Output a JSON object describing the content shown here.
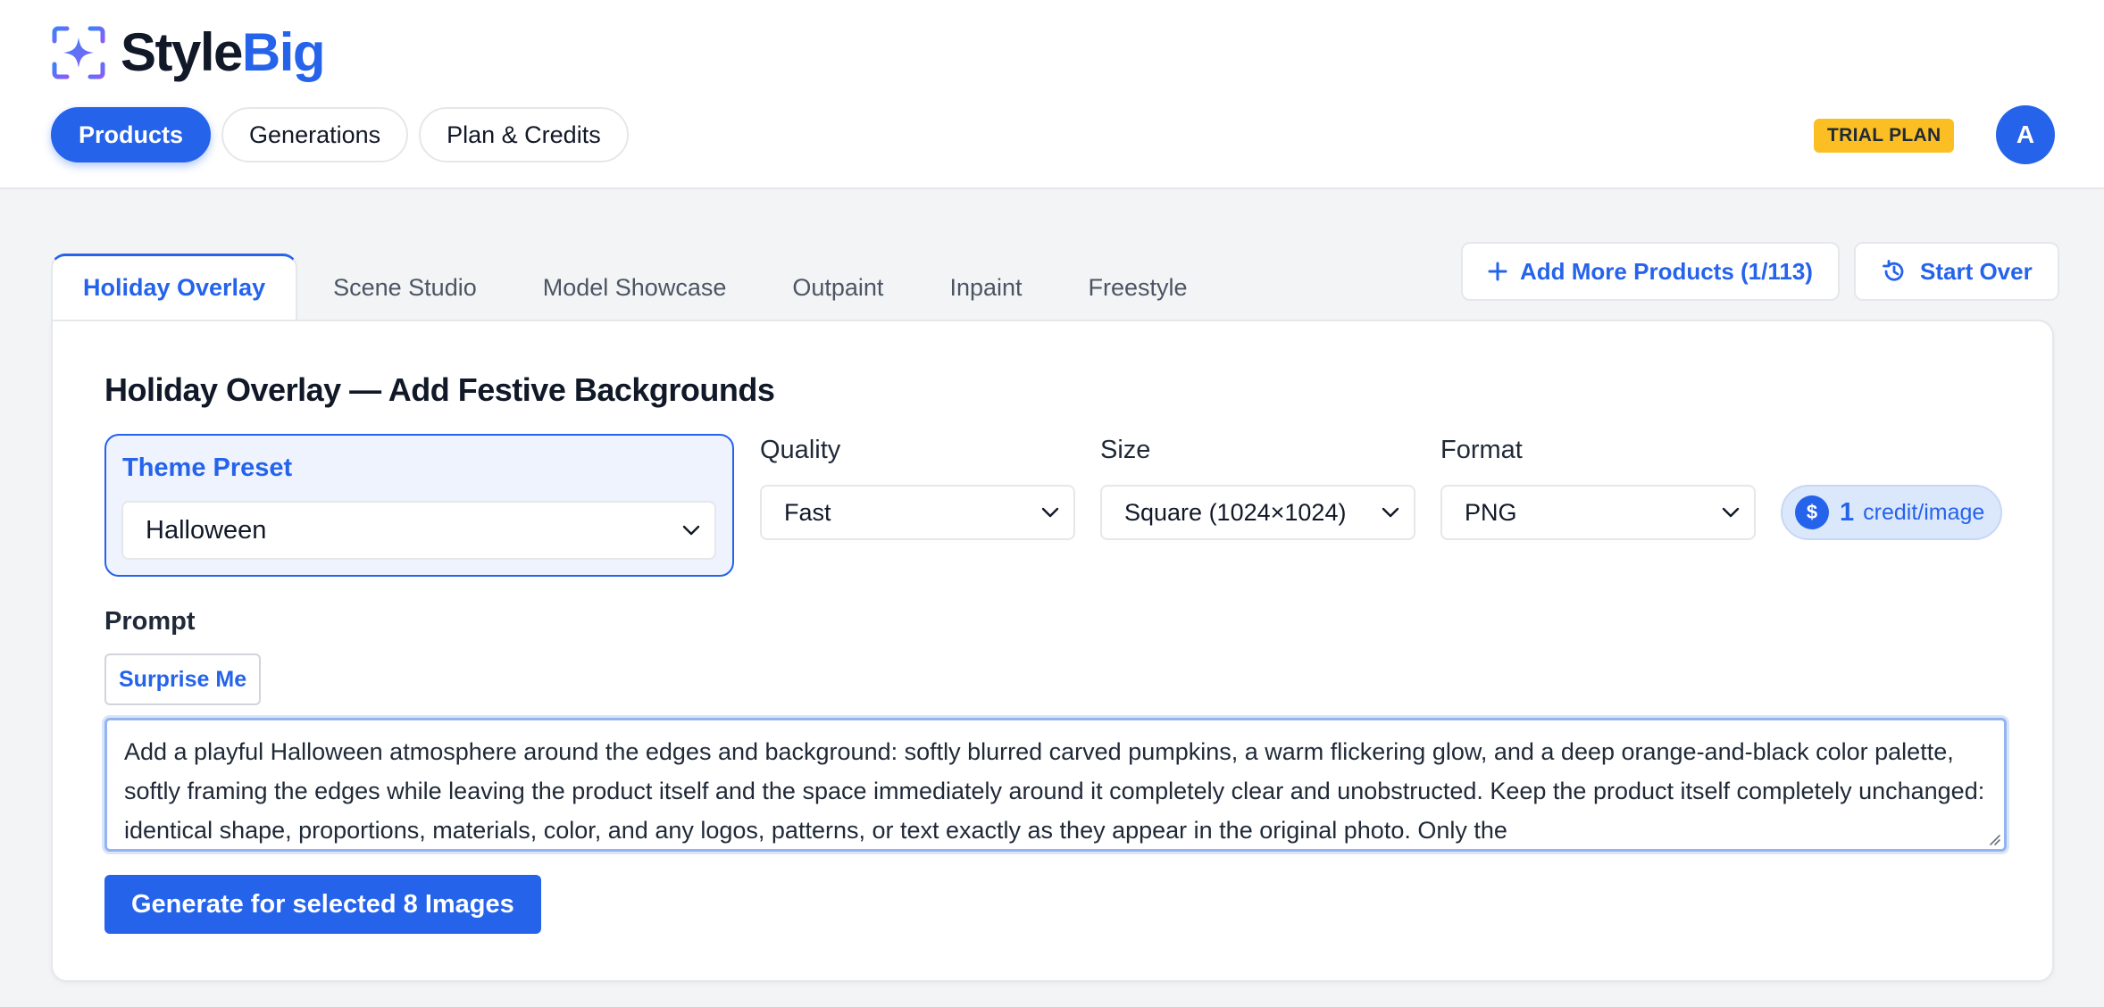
{
  "brand": {
    "name_part1": "Style",
    "name_part2": "Big",
    "logo_icon": "sparkle-frame-icon"
  },
  "nav": {
    "items": [
      {
        "label": "Products",
        "active": true
      },
      {
        "label": "Generations",
        "active": false
      },
      {
        "label": "Plan & Credits",
        "active": false
      }
    ]
  },
  "account": {
    "plan_badge": "TRIAL PLAN",
    "avatar_initial": "A"
  },
  "tabs": [
    {
      "label": "Holiday Overlay",
      "active": true
    },
    {
      "label": "Scene Studio"
    },
    {
      "label": "Model Showcase"
    },
    {
      "label": "Outpaint"
    },
    {
      "label": "Inpaint"
    },
    {
      "label": "Freestyle"
    }
  ],
  "actions": {
    "add_more_label": "Add More Products (1/113)",
    "add_more_icon": "plus-icon",
    "start_over_label": "Start Over",
    "start_over_icon": "history-icon"
  },
  "panel": {
    "title": "Holiday Overlay — Add Festive Backgrounds",
    "theme_preset": {
      "label": "Theme Preset",
      "value": "Halloween"
    },
    "quality": {
      "label": "Quality",
      "value": "Fast"
    },
    "size": {
      "label": "Size",
      "value": "Square (1024×1024)"
    },
    "format": {
      "label": "Format",
      "value": "PNG"
    },
    "credit": {
      "icon": "$",
      "amount": "1",
      "unit": "credit/image"
    },
    "prompt": {
      "label": "Prompt",
      "surprise_label": "Surprise Me",
      "text": "Add a playful Halloween atmosphere around the edges and background: softly blurred carved pumpkins, a warm flickering glow, and a deep orange-and-black color palette, softly framing the edges while leaving the product itself and the space immediately around it completely clear and unobstructed. Keep the product itself completely unchanged: identical shape, proportions, materials, color, and any logos, patterns, or text exactly as they appear in the original photo. Only the"
    },
    "generate_label": "Generate for selected 8 Images"
  },
  "colors": {
    "accent": "#2563eb",
    "badge": "#fbbf24",
    "background": "#f3f4f6"
  }
}
